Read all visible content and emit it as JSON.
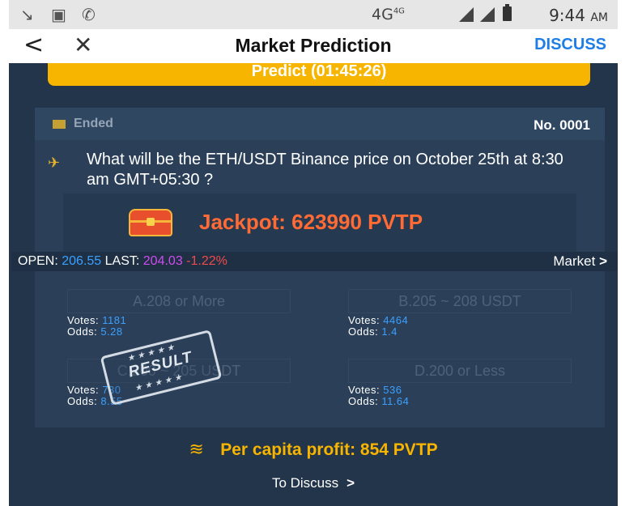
{
  "status_bar": {
    "network": "4G",
    "network_sup": "4G",
    "time": "9:44",
    "ampm": "AM"
  },
  "nav": {
    "back_glyph": "<",
    "close_glyph": "✕",
    "title": "Market Prediction",
    "discuss_label": "DISCUSS"
  },
  "predict_button": "Predict (01:45:26)",
  "card": {
    "status": "Ended",
    "number": "No. 0001",
    "question": "What will be the ETH/USDT Binance price on October 25th at 8:30 am GMT+05:30 ?",
    "jackpot": "Jackpot: 623990 PVTP",
    "open_label": "OPEN:",
    "open_value": "206.55",
    "last_label": "LAST:",
    "last_value": "204.03",
    "change": "-1.22%",
    "market_link": "Market"
  },
  "options": [
    {
      "label": "A.208 or More",
      "votes_label": "Votes:",
      "votes": "1181",
      "odds_label": "Odds:",
      "odds": "5.28"
    },
    {
      "label": "B.205 ~ 208 USDT",
      "votes_label": "Votes:",
      "votes": "4464",
      "odds_label": "Odds:",
      "odds": "1.4"
    },
    {
      "label": "C.200 ~ 205 USDT",
      "votes_label": "Votes:",
      "votes": "730",
      "odds_label": "Odds:",
      "odds": "8.55"
    },
    {
      "label": "D.200 or Less",
      "votes_label": "Votes:",
      "votes": "536",
      "odds_label": "Odds:",
      "odds": "11.64"
    }
  ],
  "result_stamp": "RESULT",
  "profit": "Per capita profit: 854 PVTP",
  "discuss_link": "To Discuss",
  "colors": {
    "accent_yellow": "#f7b500",
    "accent_blue": "#1e7ee6",
    "jackpot_orange": "#ff6a35",
    "background": "#23354a"
  },
  "icons": [
    "missed-call-icon",
    "image-icon",
    "phone-icon",
    "signal-icon",
    "battery-icon",
    "back-icon",
    "close-icon",
    "flag-icon",
    "question-star-icon",
    "treasure-chest-icon",
    "chevron-right-icon",
    "coins-icon"
  ]
}
